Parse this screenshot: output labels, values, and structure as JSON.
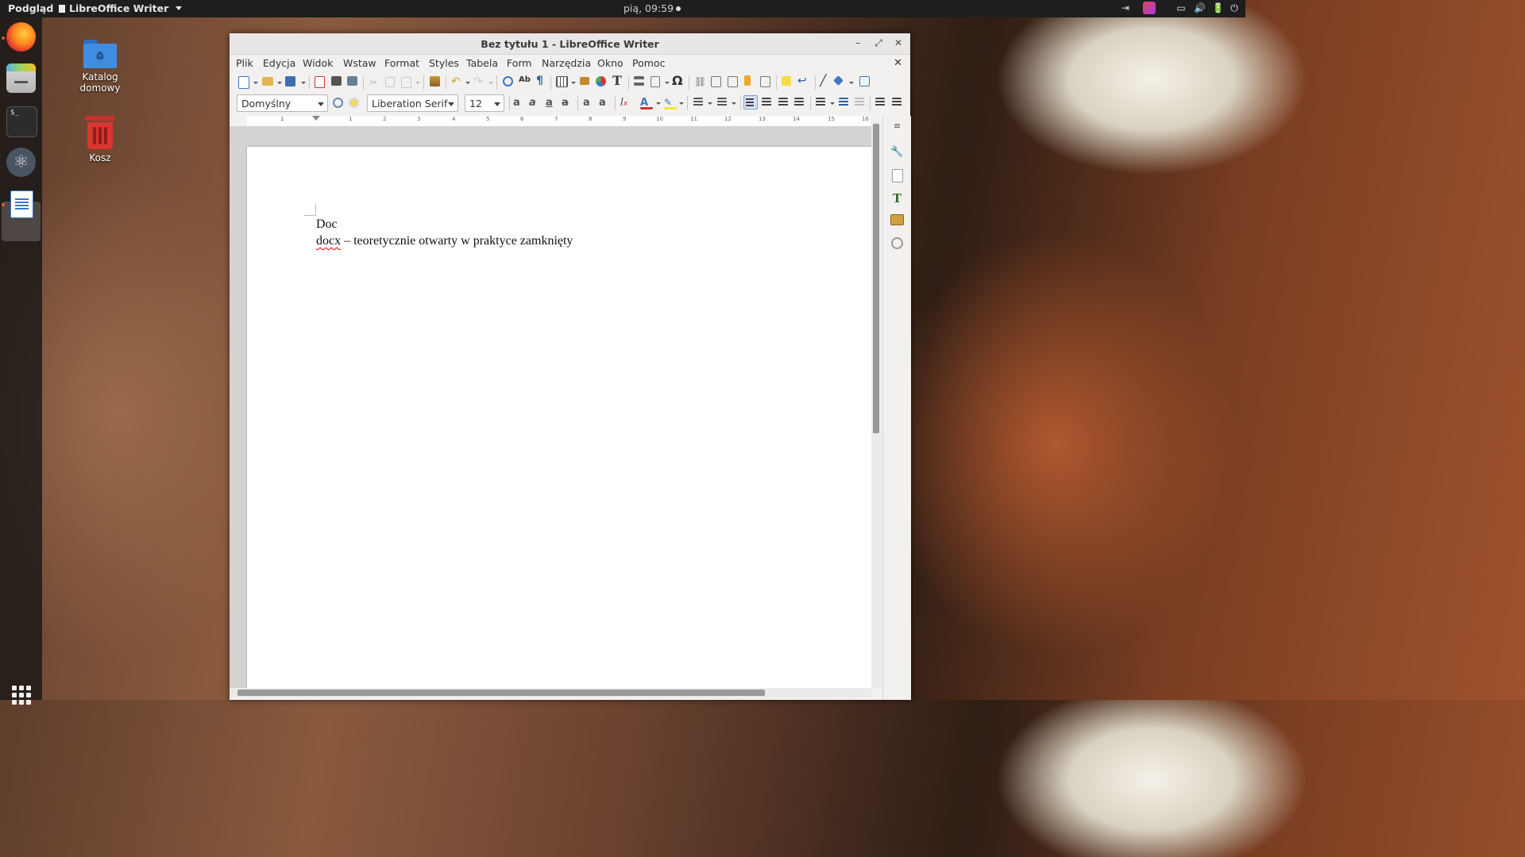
{
  "top_panel": {
    "activities": "Podgląd",
    "app_menu": "LibreOffice Writer",
    "clock": "pią, 09:59"
  },
  "desktop": {
    "icons": [
      {
        "label": "Katalog domowy"
      },
      {
        "label": "Kosz"
      }
    ]
  },
  "dock": {
    "items": [
      "firefox-icon",
      "files-icon",
      "terminal-icon",
      "atom-icon",
      "writer-icon"
    ]
  },
  "window": {
    "title": "Bez tytułu 1 - LibreOffice Writer",
    "menu": [
      "Plik",
      "Edycja",
      "Widok",
      "Wstaw",
      "Format",
      "Styles",
      "Tabela",
      "Form",
      "Narzędzia",
      "Okno",
      "Pomoc"
    ]
  },
  "format_bar": {
    "paragraph_style": "Domyślny",
    "font_name": "Liberation Serif",
    "font_size": "12"
  },
  "ruler": {
    "numbers": [
      "1",
      "1",
      "2",
      "3",
      "4",
      "5",
      "6",
      "7",
      "8",
      "9",
      "10",
      "11",
      "12",
      "13",
      "14",
      "15",
      "16"
    ]
  },
  "document": {
    "line1": "Doc",
    "line2_misspelled": "docx",
    "line2_rest": " – teoretycznie otwarty w praktyce zamknięty"
  },
  "colors": {
    "accent": "#e95420",
    "panel": "#1e1e1e",
    "window_bg": "#f2f1f0"
  }
}
